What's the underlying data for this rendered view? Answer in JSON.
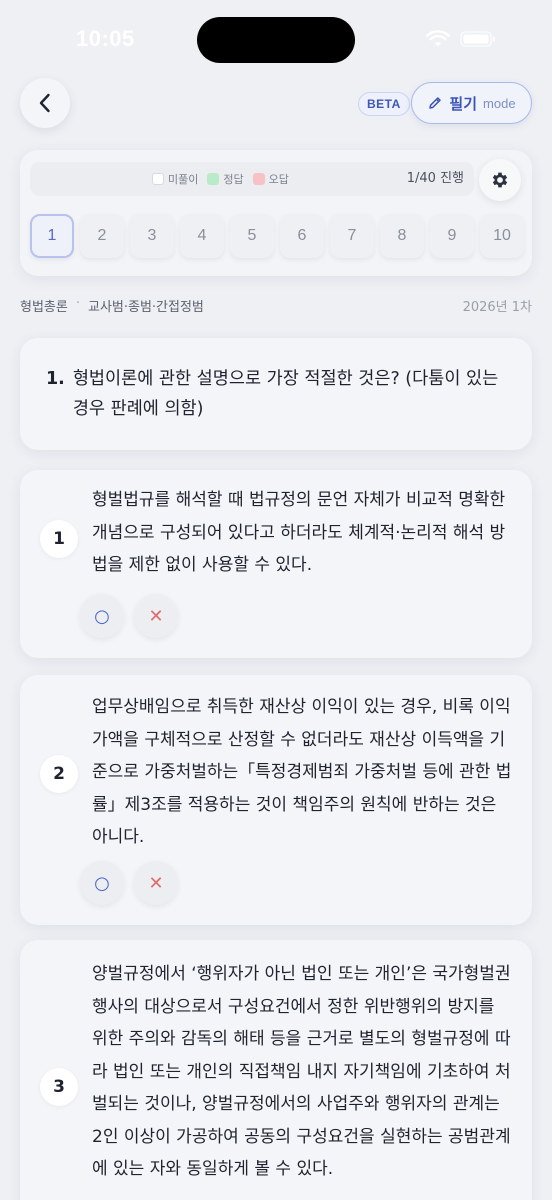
{
  "status_bar": {
    "time": "10:05"
  },
  "header": {
    "beta": "BETA",
    "mode_main": "필기",
    "mode_sub": "mode"
  },
  "legend": {
    "unsolved": "미풀이",
    "correct": "정답",
    "wrong": "오답",
    "colors": {
      "unsolved": "#ffffff",
      "correct": "#b9ebc9",
      "wrong": "#f7c2c6"
    }
  },
  "progress": "1/40 진행",
  "question_numbers": [
    "1",
    "2",
    "3",
    "4",
    "5",
    "6",
    "7",
    "8",
    "9",
    "10"
  ],
  "breadcrumb": {
    "subject": "형법총론",
    "topic": "교사범·종범·간접정범",
    "exam": "2026년 1차"
  },
  "question": {
    "number": "1.",
    "text": "형법이론에 관한 설명으로 가장 적절한 것은? (다툼이 있는 경우 판례에 의함)"
  },
  "options": [
    {
      "num": "1",
      "text": "형벌법규를 해석할 때 법규정의 문언 자체가 비교적 명확한 개념으로 구성되어 있다고 하더라도 체계적·논리적 해석 방법을 제한 없이 사용할 수 있다."
    },
    {
      "num": "2",
      "text": "업무상배임으로 취득한 재산상 이익이 있는 경우, 비록 이익 가액을 구체적으로 산정할 수 없더라도 재산상 이득액을 기준으로 가중처벌하는「특정경제범죄 가중처벌 등에 관한 법률」제3조를 적용하는 것이 책임주의 원칙에 반하는 것은 아니다."
    },
    {
      "num": "3",
      "text": "양벌규정에서 ‘행위자가 아닌 법인 또는 개인’은 국가형벌권 행사의 대상으로서 구성요건에서 정한 위반행위의 방지를 위한 주의와 감독의 해태 등을 근거로 별도의 형벌규정에 따라 법인 또는 개인의 직접책임 내지 자기책임에 기초하여 처벌되는 것이나, 양벌규정에서의 사업주와 행위자의 관계는 2인 이상이 가공하여 공동의 구성요건을 실현하는 공범관계에 있는 자와 동일하게 볼 수 있다."
    }
  ],
  "marks": {
    "o": "○",
    "x": "✕"
  }
}
